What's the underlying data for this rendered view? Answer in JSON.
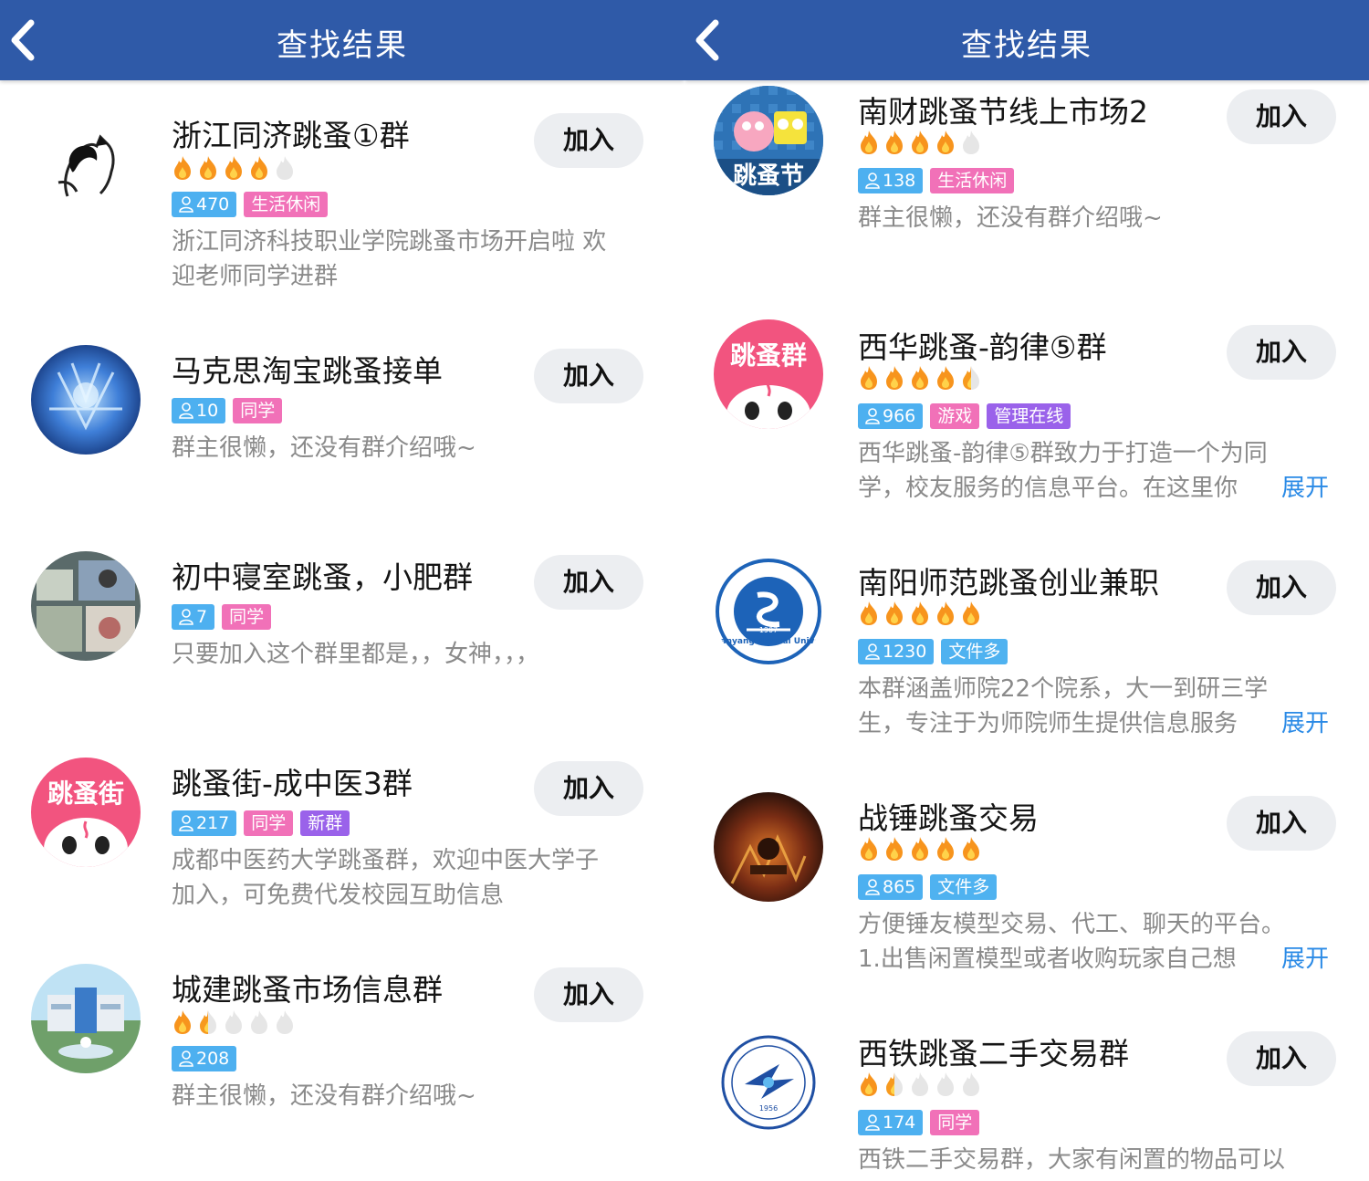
{
  "nav": {
    "title": "查找结果"
  },
  "left": [
    {
      "name": "浙江同济跳蚤①群",
      "members": "470",
      "tags": [
        "生活休闲"
      ],
      "desc": [
        "浙江同济科技职业学院跳蚤市场开启啦 欢",
        "迎老师同学进群"
      ],
      "join": "加入",
      "rating": 4
    },
    {
      "name": "马克思淘宝跳蚤接单",
      "members": "10",
      "tags": [
        "同学"
      ],
      "desc": [
        "群主很懒，还没有群介绍哦~"
      ],
      "join": "加入",
      "rating": 0
    },
    {
      "name": "初中寝室跳蚤，小肥群",
      "members": "7",
      "tags": [
        "同学"
      ],
      "desc": [
        "只要加入这个群里都是，，女神，，，"
      ],
      "join": "加入",
      "rating": 0
    },
    {
      "name": "跳蚤街-成中医3群",
      "members": "217",
      "tags": [
        "同学",
        "新群"
      ],
      "desc": [
        "成都中医药大学跳蚤群，欢迎中医大学子",
        "加入，可免费代发校园互助信息"
      ],
      "join": "加入",
      "rating": 0,
      "avatar_text": "跳蚤街"
    },
    {
      "name": "城建跳蚤市场信息群",
      "members": "208",
      "tags": [],
      "desc": [
        "群主很懒，还没有群介绍哦~"
      ],
      "join": "加入",
      "rating": 1.5
    }
  ],
  "right": [
    {
      "name": "南财跳蚤节线上市场2",
      "members": "138",
      "tags": [
        "生活休闲"
      ],
      "desc": [
        "群主很懒，还没有群介绍哦~"
      ],
      "join": "加入",
      "rating": 4,
      "avatar_text": "跳蚤节"
    },
    {
      "name": "西华跳蚤-韵律⑤群",
      "members": "966",
      "tags": [
        "游戏",
        "管理在线"
      ],
      "desc": [
        "西华跳蚤-韵律⑤群致力于打造一个为同",
        "学，校友服务的信息平台。在这里你"
      ],
      "join": "加入",
      "rating": 4.5,
      "expand": "展开",
      "avatar_text": "跳蚤群"
    },
    {
      "name": "南阳师范跳蚤创业兼职",
      "members": "1230",
      "tags": [
        "文件多"
      ],
      "desc": [
        "本群涵盖师院22个院系，大一到研三学",
        "生，专注于为师院师生提供信息服务"
      ],
      "join": "加入",
      "rating": 5,
      "expand": "展开",
      "avatar_text": "Nanyang Normal University",
      "avatar_year": "1907"
    },
    {
      "name": "战锤跳蚤交易",
      "members": "865",
      "tags": [
        "文件多"
      ],
      "desc": [
        "方便锤友模型交易、代工、聊天的平台。",
        "1.出售闲置模型或者收购玩家自己想"
      ],
      "join": "加入",
      "rating": 5,
      "expand": "展开"
    },
    {
      "name": "西铁跳蚤二手交易群",
      "members": "174",
      "tags": [
        "同学"
      ],
      "desc": [
        "西铁二手交易群，大家有闲置的物品可以"
      ],
      "join": "加入",
      "rating": 1.5,
      "avatar_year": "1956"
    }
  ]
}
